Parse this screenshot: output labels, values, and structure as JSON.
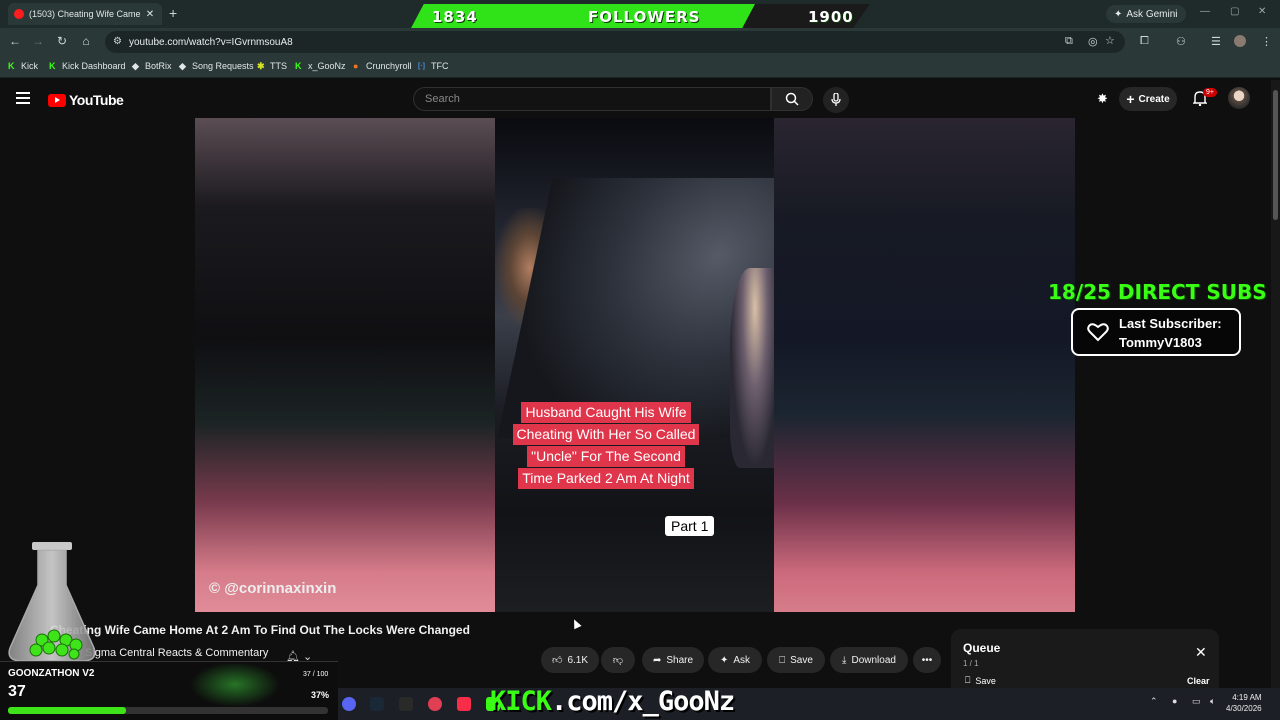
{
  "browser": {
    "tab_title": "(1503) Cheating Wife Came",
    "url": "youtube.com/watch?v=IGvrnmsouA8",
    "ask_gemini": "Ask Gemini",
    "bookmarks": [
      "Kick",
      "Kick Dashboard",
      "BotRix",
      "Song Requests",
      "TTS",
      "x_GooNz",
      "Crunchyroll",
      "TFC"
    ]
  },
  "follower_goal": {
    "current": "1834",
    "label": "FOLLOWERS",
    "goal": "1900",
    "progress": 0.75
  },
  "youtube": {
    "logo_text": "YouTube",
    "search_placeholder": "Search",
    "create_label": "Create",
    "notif_badge": "9+"
  },
  "video": {
    "caption_lines": [
      "Husband Caught His Wife",
      "Cheating With Her So Called",
      "\"Uncle\" For The Second",
      "Time Parked 2 Am At Night"
    ],
    "part_label": "Part 1",
    "watermark": "© @corinnaxinxin",
    "title": "Cheating Wife Came Home At 2 Am To Find Out The Locks Were Changed",
    "channel": "Sigma Central Reacts & Commentary"
  },
  "actions": {
    "likes": "6.1K",
    "share": "Share",
    "ask": "Ask",
    "save": "Save",
    "download": "Download"
  },
  "queue": {
    "title": "Queue",
    "count": "1 / 1",
    "save": "Save",
    "clear": "Clear"
  },
  "overlay": {
    "direct_subs": "18/25 DIRECT SUBS",
    "last_sub_label": "Last Subscriber:",
    "last_sub_name": "TommyV1803",
    "goonzathon_name": "GOONZATHON V2",
    "goonzathon_count": "37",
    "goonzathon_frac": "37 / 100",
    "goonzathon_pct": "37%",
    "goonzathon_progress": 0.37,
    "kick_url_k": "KICK",
    "kick_url_rest": ".com/x_GooNz"
  },
  "system": {
    "time": "4:19 AM",
    "date": "4/30/2026"
  },
  "colors": {
    "accent_green": "#39ff14",
    "youtube_red": "#ff0000",
    "caption_red": "#e0364c"
  }
}
